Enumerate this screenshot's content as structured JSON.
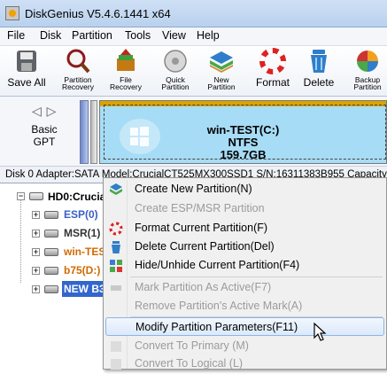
{
  "window": {
    "title": "DiskGenius V5.4.6.1441 x64"
  },
  "menu": [
    "File",
    "Disk",
    "Partition",
    "Tools",
    "View",
    "Help"
  ],
  "toolbar": [
    {
      "label": "Save All",
      "icon": "save-icon",
      "small": false
    },
    {
      "label": "Partition Recovery",
      "label1": "Partition",
      "label2": "Recovery",
      "icon": "partition-recovery-icon",
      "small": true
    },
    {
      "label": "File Recovery",
      "label1": "File",
      "label2": "Recovery",
      "icon": "file-recovery-icon",
      "small": true
    },
    {
      "label": "Quick Partition",
      "label1": "Quick",
      "label2": "Partition",
      "icon": "quick-partition-icon",
      "small": true
    },
    {
      "label": "New Partition",
      "label1": "New",
      "label2": "Partition",
      "icon": "new-partition-icon",
      "small": true
    },
    {
      "label": "Format",
      "icon": "format-icon",
      "small": false
    },
    {
      "label": "Delete",
      "icon": "delete-icon",
      "small": false
    },
    {
      "label": "Backup Partition",
      "label1": "Backup",
      "label2": "Partition",
      "icon": "backup-partition-icon",
      "small": true
    }
  ],
  "disk_map": {
    "style_line1": "Basic",
    "style_line2": "GPT",
    "partition_name": "win-TEST(C:)",
    "partition_fs": "NTFS",
    "partition_size": "159.7GB"
  },
  "disk_info": "Disk 0 Adapter:SATA  Model:CrucialCT525MX300SSD1  S/N:16311383B955  Capacity",
  "tree": {
    "root": "HD0:Crucial",
    "items": [
      {
        "label": "ESP(0)",
        "color": "#3b5fc7"
      },
      {
        "label": "MSR(1)",
        "color": "#333333"
      },
      {
        "label": "win-TES",
        "color": "#d06a00"
      },
      {
        "label": "b75(D:)",
        "color": "#d06a00"
      },
      {
        "label": "NEW B3",
        "color": "#ffffff",
        "selected": true
      }
    ]
  },
  "context_menu": [
    {
      "label": "Create New Partition(N)",
      "enabled": true,
      "icon": "new-partition-icon"
    },
    {
      "label": "Create ESP/MSR Partition",
      "enabled": false,
      "icon": ""
    },
    {
      "label": "Format Current Partition(F)",
      "enabled": true,
      "icon": "format-icon"
    },
    {
      "label": "Delete Current Partition(Del)",
      "enabled": true,
      "icon": "delete-icon"
    },
    {
      "label": "Hide/Unhide Current Partition(F4)",
      "enabled": true,
      "icon": "hide-unhide-icon"
    },
    {
      "label": "Mark Partition As Active(F7)",
      "enabled": false,
      "icon": "mark-active-icon"
    },
    {
      "label": "Remove Partition's Active Mark(A)",
      "enabled": false,
      "icon": ""
    },
    {
      "label": "Modify Partition Parameters(F11)",
      "enabled": true,
      "highlighted": true,
      "icon": ""
    },
    {
      "label": "Convert To Primary (M)",
      "enabled": false,
      "icon": "convert-icon"
    },
    {
      "label": "Convert To Logical (L)",
      "enabled": false,
      "icon": "convert-icon"
    }
  ],
  "colors": {
    "selection": "#3366cc",
    "partition_fill": "#a7dcf6",
    "accent": "#d9a400"
  }
}
